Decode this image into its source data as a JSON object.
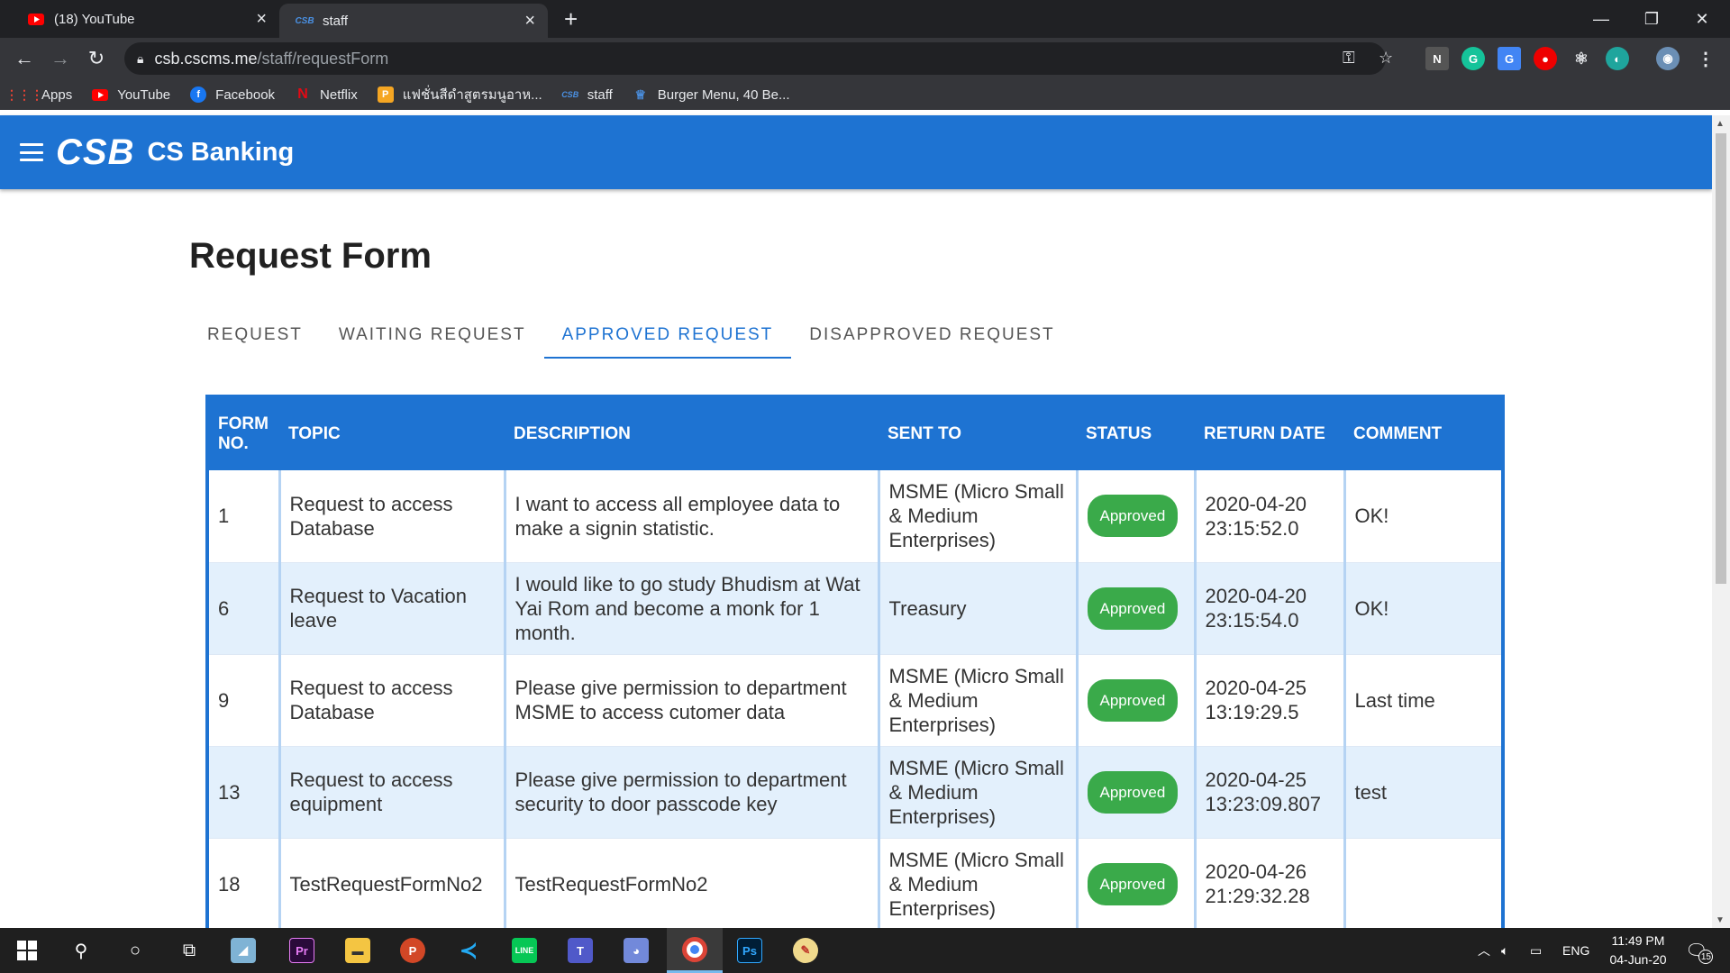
{
  "browser": {
    "tabs": [
      {
        "label": "(18) YouTube",
        "active": false
      },
      {
        "label": "staff",
        "active": true
      }
    ],
    "url_host": "csb.cscms.me",
    "url_path": "/staff/requestForm",
    "bookmarks": [
      {
        "label": "Apps",
        "icon": "apps-grid-icon"
      },
      {
        "label": "YouTube",
        "icon": "youtube-icon"
      },
      {
        "label": "Facebook",
        "icon": "facebook-icon"
      },
      {
        "label": "Netflix",
        "icon": "netflix-icon"
      },
      {
        "label": "แฟชั่นสีดำสูตรมนูอาห...",
        "icon": "p-icon"
      },
      {
        "label": "staff",
        "icon": "csb-icon"
      },
      {
        "label": "Burger Menu, 40 Be...",
        "icon": "burger-icon"
      }
    ],
    "tab_favicon_csb": "CSB"
  },
  "app": {
    "logo": "CSB",
    "name": "CS Banking",
    "accent": "#1e73d2"
  },
  "page": {
    "title": "Request Form",
    "tabs": [
      {
        "label": "REQUEST",
        "active": false
      },
      {
        "label": "WAITING REQUEST",
        "active": false
      },
      {
        "label": "APPROVED REQUEST",
        "active": true
      },
      {
        "label": "DISAPPROVED REQUEST",
        "active": false
      }
    ]
  },
  "table": {
    "headers": [
      "FORM NO.",
      "TOPIC",
      "DESCRIPTION",
      "SENT TO",
      "STATUS",
      "RETURN DATE",
      "COMMENT"
    ],
    "rows": [
      {
        "no": "1",
        "topic": "Request to access Database",
        "description": "I want to access all employee data to make a signin statistic.",
        "sent_to": "MSME (Micro Small & Medium Enterprises)",
        "status": "Approved",
        "return_date": "2020-04-20 23:15:52.0",
        "comment": "OK!"
      },
      {
        "no": "6",
        "topic": "Request to Vacation leave",
        "description": "I would like to go study Bhudism at Wat Yai Rom and become a monk for 1 month.",
        "sent_to": "Treasury",
        "status": "Approved",
        "return_date": "2020-04-20 23:15:54.0",
        "comment": "OK!"
      },
      {
        "no": "9",
        "topic": "Request to access Database",
        "description": "Please give permission to department MSME to access cutomer data",
        "sent_to": "MSME (Micro Small & Medium Enterprises)",
        "status": "Approved",
        "return_date": "2020-04-25 13:19:29.5",
        "comment": "Last time"
      },
      {
        "no": "13",
        "topic": "Request to access equipment",
        "description": "Please give permission to department security to door passcode key",
        "sent_to": "MSME (Micro Small & Medium Enterprises)",
        "status": "Approved",
        "return_date": "2020-04-25 13:23:09.807",
        "comment": "test"
      },
      {
        "no": "18",
        "topic": "TestRequestFormNo2",
        "description": "TestRequestFormNo2",
        "sent_to": "MSME (Micro Small & Medium Enterprises)",
        "status": "Approved",
        "return_date": "2020-04-26 21:29:32.28",
        "comment": ""
      }
    ]
  },
  "taskbar": {
    "lang": "ENG",
    "time": "11:49 PM",
    "date": "04-Jun-20",
    "notifications": "15"
  }
}
